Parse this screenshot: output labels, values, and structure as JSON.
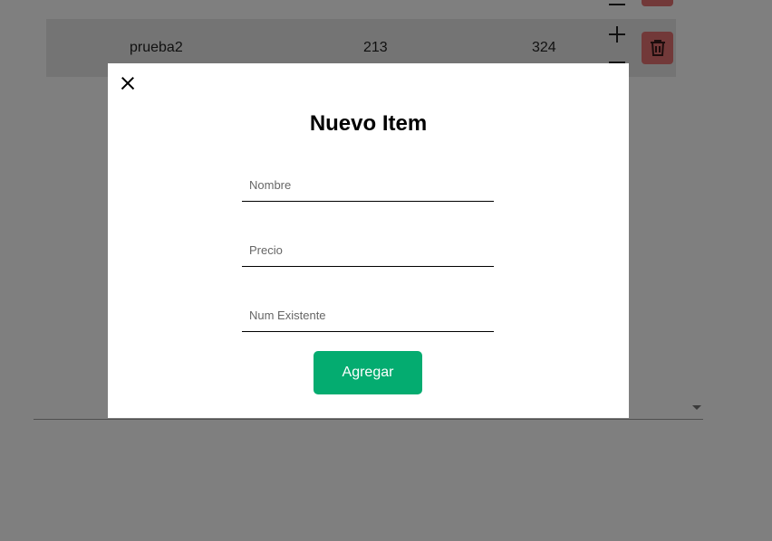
{
  "table": {
    "rows": [
      {
        "name": "",
        "price": "",
        "stock": ""
      },
      {
        "name": "prueba2",
        "price": "213",
        "stock": "324"
      }
    ]
  },
  "modal": {
    "title": "Nuevo Item",
    "fields": {
      "name_placeholder": "Nombre",
      "price_placeholder": "Precio",
      "stock_placeholder": "Num Existente"
    },
    "submit_label": "Agregar"
  },
  "colors": {
    "primary_button": "#04ac70",
    "delete_button": "#e57373",
    "overlay": "rgba(0,0,0,0.5)"
  },
  "icons": [
    "close-icon",
    "plus-icon",
    "minus-icon",
    "trash-icon"
  ]
}
